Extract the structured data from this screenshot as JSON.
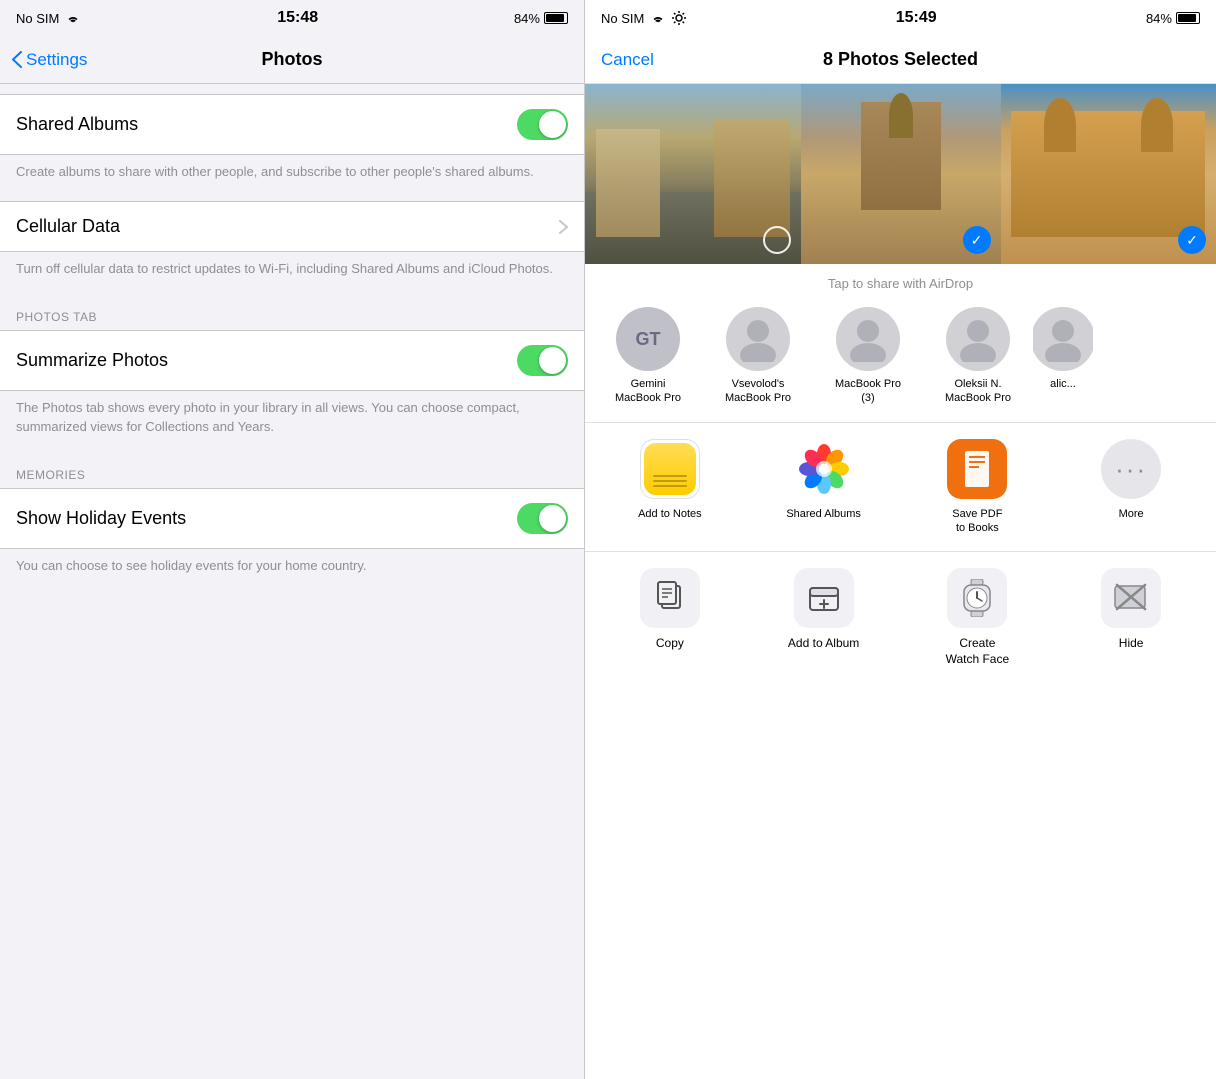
{
  "left": {
    "status_bar": {
      "no_sim": "No SIM",
      "wifi": "WiFi",
      "time": "15:48",
      "battery": "84%"
    },
    "nav": {
      "back_label": "Settings",
      "title": "Photos"
    },
    "sections": [
      {
        "id": "shared-albums",
        "label": "Shared Albums",
        "toggle": true,
        "description": "Create albums to share with other people, and subscribe to other people's shared albums."
      },
      {
        "id": "cellular-data",
        "label": "Cellular Data",
        "has_chevron": true,
        "description": "Turn off cellular data to restrict updates to Wi-Fi, including Shared Albums and iCloud Photos."
      },
      {
        "id": "photos-tab-header",
        "section_header": "PHOTOS TAB"
      },
      {
        "id": "summarize-photos",
        "label": "Summarize Photos",
        "toggle": true,
        "description": "The Photos tab shows every photo in your library in all views. You can choose compact, summarized views for Collections and Years."
      },
      {
        "id": "memories-header",
        "section_header": "MEMORIES"
      },
      {
        "id": "show-holiday-events",
        "label": "Show Holiday Events",
        "toggle": true,
        "description": "You can choose to see holiday events for your home country."
      }
    ]
  },
  "right": {
    "status_bar": {
      "no_sim": "No SIM",
      "wifi": "WiFi",
      "time": "15:49",
      "battery": "84%"
    },
    "nav": {
      "cancel_label": "Cancel",
      "title": "8 Photos Selected"
    },
    "airdrop": {
      "title": "Tap to share with AirDrop",
      "contacts": [
        {
          "id": "gemini",
          "initials": "GT",
          "name": "Gemini\nMacBook Pro"
        },
        {
          "id": "vsevolod",
          "name": "Vsevolod's\nMacBook Pro"
        },
        {
          "id": "macbook-3",
          "name": "MacBook Pro\n(3)"
        },
        {
          "id": "oleksii",
          "name": "Oleksii N.\nMacBook Pro"
        },
        {
          "id": "alic",
          "name": "alic..."
        }
      ]
    },
    "app_actions": [
      {
        "id": "add-to-notes",
        "label": "Add to Notes",
        "icon_type": "notes"
      },
      {
        "id": "shared-albums",
        "label": "Shared Albums",
        "icon_type": "photos"
      },
      {
        "id": "save-pdf-to-books",
        "label": "Save PDF\nto Books",
        "icon_type": "books"
      },
      {
        "id": "more",
        "label": "More",
        "icon_type": "more"
      }
    ],
    "utility_actions": [
      {
        "id": "copy",
        "label": "Copy",
        "icon": "copy"
      },
      {
        "id": "add-to-album",
        "label": "Add to Album",
        "icon": "add-album"
      },
      {
        "id": "create-watch-face",
        "label": "Create\nWatch Face",
        "icon": "watch"
      },
      {
        "id": "hide",
        "label": "Hide",
        "icon": "hide"
      }
    ]
  }
}
